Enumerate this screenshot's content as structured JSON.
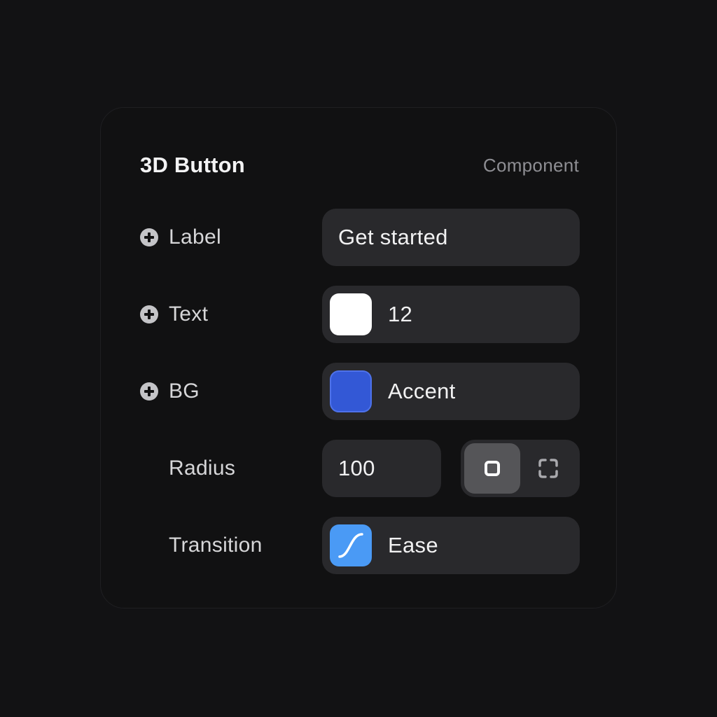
{
  "panel": {
    "title": "3D Button",
    "subtitle": "Component"
  },
  "rows": {
    "label": {
      "name": "Label",
      "value": "Get started",
      "icon": "plus-circle-icon"
    },
    "text": {
      "name": "Text",
      "value": "12",
      "swatch_color": "#ffffff",
      "icon": "plus-circle-icon"
    },
    "bg": {
      "name": "BG",
      "value": "Accent",
      "swatch_color": "#3358d6",
      "icon": "plus-circle-icon"
    },
    "radius": {
      "name": "Radius",
      "value": "100",
      "toggle": {
        "options": [
          "uniform-corners-icon",
          "individual-corners-icon"
        ],
        "selected": "uniform-corners-icon"
      }
    },
    "transition": {
      "name": "Transition",
      "value": "Ease",
      "swatch_color": "#4a9af5",
      "icon": "ease-curve-icon"
    }
  }
}
